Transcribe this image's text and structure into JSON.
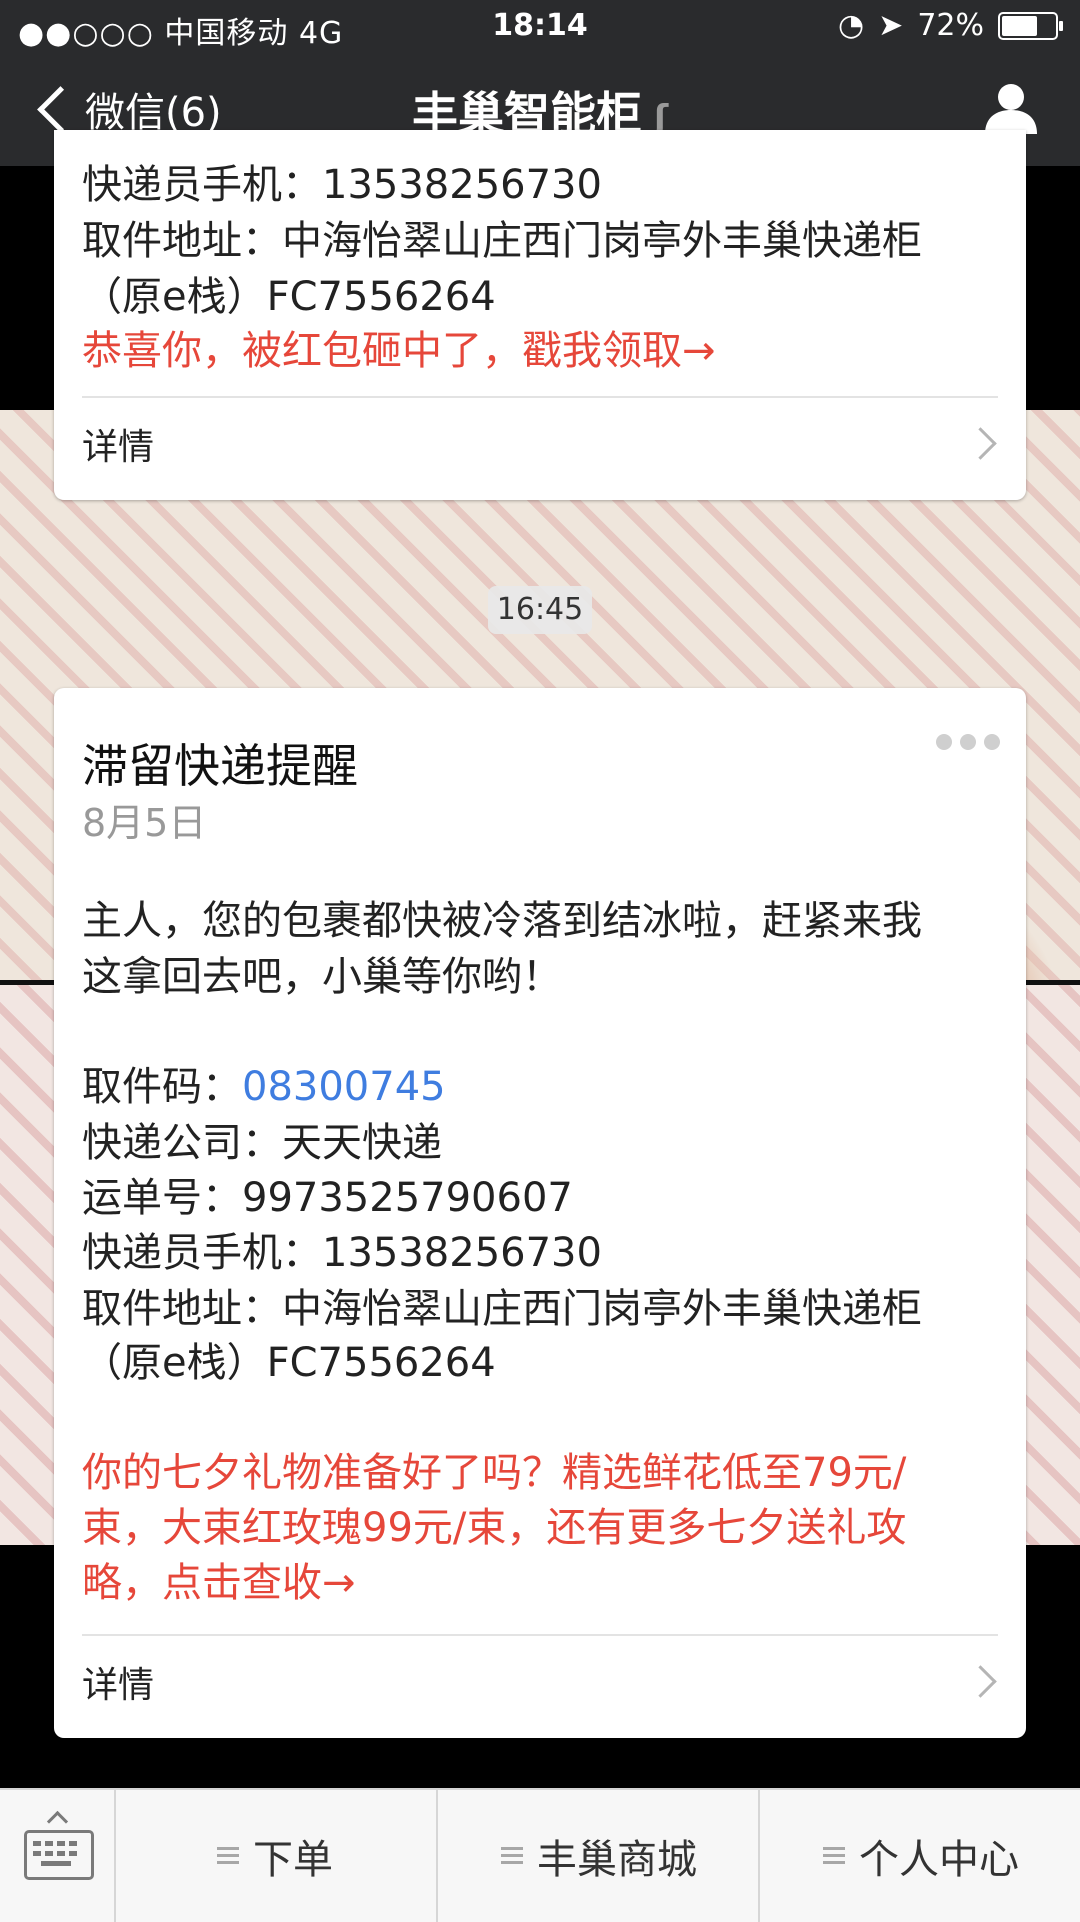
{
  "status_bar": {
    "carrier": "●●○○○ 中国移动   4G",
    "time": "18:14",
    "battery": "72%",
    "battery_level": 0.72
  },
  "nav": {
    "back_label": "微信(6)",
    "title": "丰巢智能柜",
    "icons": [
      "chevron-left-icon",
      "ear-icon",
      "person-icon"
    ]
  },
  "card1": {
    "courier_phone": "快递员手机：13538256730",
    "address_line1": "取件地址：中海怡翠山庄西门岗亭外丰巢快递柜",
    "address_line2": "（原e栈）FC7556264",
    "promo": "恭喜你，被红包砸中了，戳我领取→",
    "detail_label": "详情"
  },
  "timestamp": "16:45",
  "card2": {
    "title": "滞留快递提醒",
    "date": "8月5日",
    "message_line1": "主人，您的包裹都快被冷落到结冰啦，赶紧来我",
    "message_line2": "这拿回去吧，小巢等你哟！",
    "code_label": "取件码：",
    "code_value": "08300745",
    "company": "快递公司：天天快递",
    "waybill": "运单号：9973525790607",
    "courier_phone": "快递员手机：13538256730",
    "address_line1": "取件地址：中海怡翠山庄西门岗亭外丰巢快递柜",
    "address_line2": "（原e栈）FC7556264",
    "promo_line1": "你的七夕礼物准备好了吗？精选鲜花低至79元/",
    "promo_line2": "束，大束红玫瑰99元/束，还有更多七夕送礼攻",
    "promo_line3": "略，点击查收→",
    "detail_label": "详情"
  },
  "bottom_menu": {
    "items": [
      "下单",
      "丰巢商城",
      "个人中心"
    ]
  },
  "colors": {
    "navbar": "#2a2b2d",
    "promo_red": "#e6473a",
    "code_blue": "#3f7de0"
  }
}
